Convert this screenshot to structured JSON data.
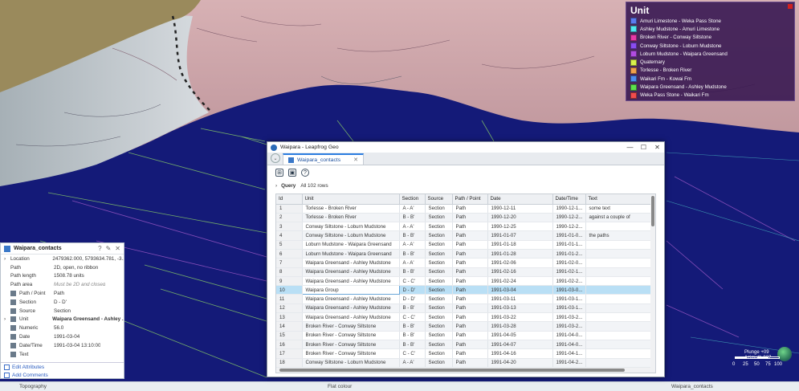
{
  "legend": {
    "title": "Unit",
    "items": [
      {
        "label": "Amuri Limestone - Weka Pass Stone",
        "color": "#5b7cf0"
      },
      {
        "label": "Ashley Mudstone - Amuri Limestone",
        "color": "#4fe8f0"
      },
      {
        "label": "Broken River - Conway Siltstone",
        "color": "#e83aa8"
      },
      {
        "label": "Conway Siltstone - Loburn Mudstone",
        "color": "#8a4cf0"
      },
      {
        "label": "Loburn Mudstone - Waipara Greensand",
        "color": "#b04ce0"
      },
      {
        "label": "Quaternary",
        "color": "#d8f04c"
      },
      {
        "label": "Torlesse - Broken River",
        "color": "#f0a04c"
      },
      {
        "label": "Waikari Fm - Kowai Fm",
        "color": "#4c8cf0"
      },
      {
        "label": "Waipara Greensand - Ashley Mudstone",
        "color": "#5ce04c"
      },
      {
        "label": "Weka Pass Stone - Waikari Fm",
        "color": "#f04c4c"
      }
    ]
  },
  "window": {
    "title": "Waipara - Leapfrog Geo",
    "tab": "Waipara_contacts",
    "query_label": "Query",
    "query_value": "All 102 rows",
    "columns": [
      "Id",
      "Unit",
      "Section",
      "Source",
      "Path / Point",
      "Date",
      "Date/Time",
      "Text"
    ],
    "rows": [
      [
        "1",
        "Torlesse - Broken River",
        "A - A'",
        "Section",
        "Path",
        "1990-12-11",
        "1990-12-1...",
        "some text"
      ],
      [
        "2",
        "Torlesse - Broken River",
        "B - B'",
        "Section",
        "Path",
        "1990-12-20",
        "1990-12-2...",
        "against a couple of"
      ],
      [
        "3",
        "Conway Siltstone - Loburn Mudstone",
        "A - A'",
        "Section",
        "Path",
        "1990-12-25",
        "1990-12-2...",
        ""
      ],
      [
        "4",
        "Conway Siltstone - Loburn Mudstone",
        "B - B'",
        "Section",
        "Path",
        "1991-01-07",
        "1991-01-0...",
        "the paths"
      ],
      [
        "5",
        "Loburn Mudstone - Waipara Greensand",
        "A - A'",
        "Section",
        "Path",
        "1991-01-18",
        "1991-01-1...",
        ""
      ],
      [
        "6",
        "Loburn Mudstone - Waipara Greensand",
        "B - B'",
        "Section",
        "Path",
        "1991-01-28",
        "1991-01-2...",
        ""
      ],
      [
        "7",
        "Waipara Greensand - Ashley Mudstone",
        "A - A'",
        "Section",
        "Path",
        "1991-02-06",
        "1991-02-0...",
        ""
      ],
      [
        "8",
        "Waipara Greensand - Ashley Mudstone",
        "B - B'",
        "Section",
        "Path",
        "1991-02-16",
        "1991-02-1...",
        ""
      ],
      [
        "9",
        "Waipara Greensand - Ashley Mudstone",
        "C - C'",
        "Section",
        "Path",
        "1991-02-24",
        "1991-02-2...",
        ""
      ],
      [
        "10",
        "Waipara Group",
        "D - D'",
        "Section",
        "Path",
        "1991-03-04",
        "1991-03-0...",
        ""
      ],
      [
        "11",
        "Waipara Greensand - Ashley Mudstone",
        "D - D'",
        "Section",
        "Path",
        "1991-03-11",
        "1991-03-1...",
        ""
      ],
      [
        "12",
        "Waipara Greensand - Ashley Mudstone",
        "B - B'",
        "Section",
        "Path",
        "1991-03-13",
        "1991-03-1...",
        ""
      ],
      [
        "13",
        "Waipara Greensand - Ashley Mudstone",
        "C - C'",
        "Section",
        "Path",
        "1991-03-22",
        "1991-03-2...",
        ""
      ],
      [
        "14",
        "Broken River - Conway Siltstone",
        "B - B'",
        "Section",
        "Path",
        "1991-03-28",
        "1991-03-2...",
        ""
      ],
      [
        "15",
        "Broken River - Conway Siltstone",
        "B - B'",
        "Section",
        "Path",
        "1991-04-05",
        "1991-04-0...",
        ""
      ],
      [
        "16",
        "Broken River - Conway Siltstone",
        "B - B'",
        "Section",
        "Path",
        "1991-04-07",
        "1991-04-0...",
        ""
      ],
      [
        "17",
        "Broken River - Conway Siltstone",
        "C - C'",
        "Section",
        "Path",
        "1991-04-16",
        "1991-04-1...",
        ""
      ],
      [
        "18",
        "Conway Siltstone - Loburn Mudstone",
        "A - A'",
        "Section",
        "Path",
        "1991-04-20",
        "1991-04-2...",
        ""
      ],
      [
        "19",
        "Conway Siltstone - Loburn Mudstone",
        "B - B'",
        "Section",
        "Path",
        "1991-04-22",
        "1991-04-2...",
        ""
      ]
    ],
    "selected_row_index": 9
  },
  "properties": {
    "title": "Waipara_contacts",
    "rows": [
      {
        "key": "Location",
        "value": "2479362.000, 5793634.781, -3...",
        "style": "",
        "icon": "",
        "expand": true
      },
      {
        "key": "Path",
        "value": "2D, open, no ribbon",
        "style": "",
        "icon": "",
        "expand": false
      },
      {
        "key": "Path length",
        "value": "1508.78 units",
        "style": "",
        "icon": "",
        "expand": false
      },
      {
        "key": "Path area",
        "value": "Must be 2D and closed",
        "style": "it",
        "icon": "",
        "expand": false
      },
      {
        "key": "Path / Point",
        "value": "Path",
        "style": "",
        "icon": "path-icon",
        "expand": false
      },
      {
        "key": "Section",
        "value": "D - D'",
        "style": "",
        "icon": "section-icon",
        "expand": false
      },
      {
        "key": "Source",
        "value": "Section",
        "style": "",
        "icon": "source-icon",
        "expand": false
      },
      {
        "key": "Unit",
        "value": "Waipara Greensand - Ashley ...",
        "style": "b",
        "icon": "unit-icon",
        "expand": true
      },
      {
        "key": "Numeric",
        "value": "56.0",
        "style": "",
        "icon": "numeric-icon",
        "expand": false
      },
      {
        "key": "Date",
        "value": "1991-03-04",
        "style": "",
        "icon": "date-icon",
        "expand": false
      },
      {
        "key": "Date/Time",
        "value": "1991-03-04 13:10:00",
        "style": "",
        "icon": "datetime-icon",
        "expand": false
      },
      {
        "key": "Text",
        "value": "",
        "style": "",
        "icon": "text-icon",
        "expand": false
      }
    ],
    "links": [
      "Edit Attributes",
      "Add Comments"
    ]
  },
  "view": {
    "plunge": "Plunge +09",
    "azimuth": "Azimuth 027",
    "scale_labels": [
      "0",
      "25",
      "50",
      "75",
      "100"
    ]
  },
  "statusbar": {
    "left": "Topography",
    "middle": "Flat colour",
    "right": "Waipara_contacts"
  }
}
